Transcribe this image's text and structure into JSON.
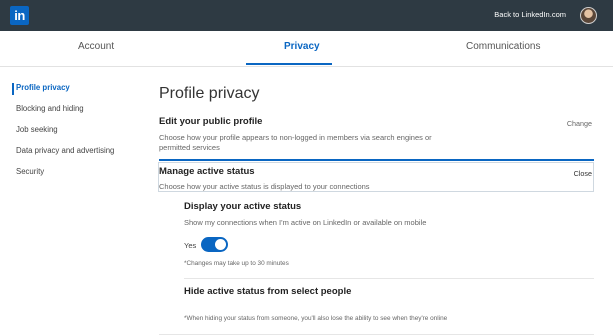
{
  "topbar": {
    "logo_text": "in",
    "back_link": "Back to LinkedIn.com"
  },
  "tabs": [
    {
      "label": "Account"
    },
    {
      "label": "Privacy",
      "active": true
    },
    {
      "label": "Communications"
    }
  ],
  "sidebar": {
    "items": [
      {
        "label": "Profile privacy",
        "active": true
      },
      {
        "label": "Blocking and hiding"
      },
      {
        "label": "Job seeking"
      },
      {
        "label": "Data privacy and advertising"
      },
      {
        "label": "Security"
      }
    ]
  },
  "main": {
    "title": "Profile privacy",
    "public_profile": {
      "title": "Edit your public profile",
      "description": "Choose how your profile appears to non-logged in members via search engines or permitted services",
      "action": "Change"
    },
    "active_status": {
      "title": "Manage active status",
      "description": "Choose how your active status is displayed to your connections",
      "action": "Close",
      "display": {
        "title": "Display your active status",
        "description": "Show my connections when I'm active on LinkedIn or available on mobile",
        "toggle_label": "Yes",
        "toggle_on": true,
        "note": "*Changes may take up to 30 minutes"
      },
      "hide": {
        "title": "Hide active status from select people",
        "note": "*When hiding your status from someone, you'll also lose the ability to see when they're online"
      }
    }
  },
  "colors": {
    "topbar": "#2e3a43",
    "accent": "#0a66c2"
  }
}
